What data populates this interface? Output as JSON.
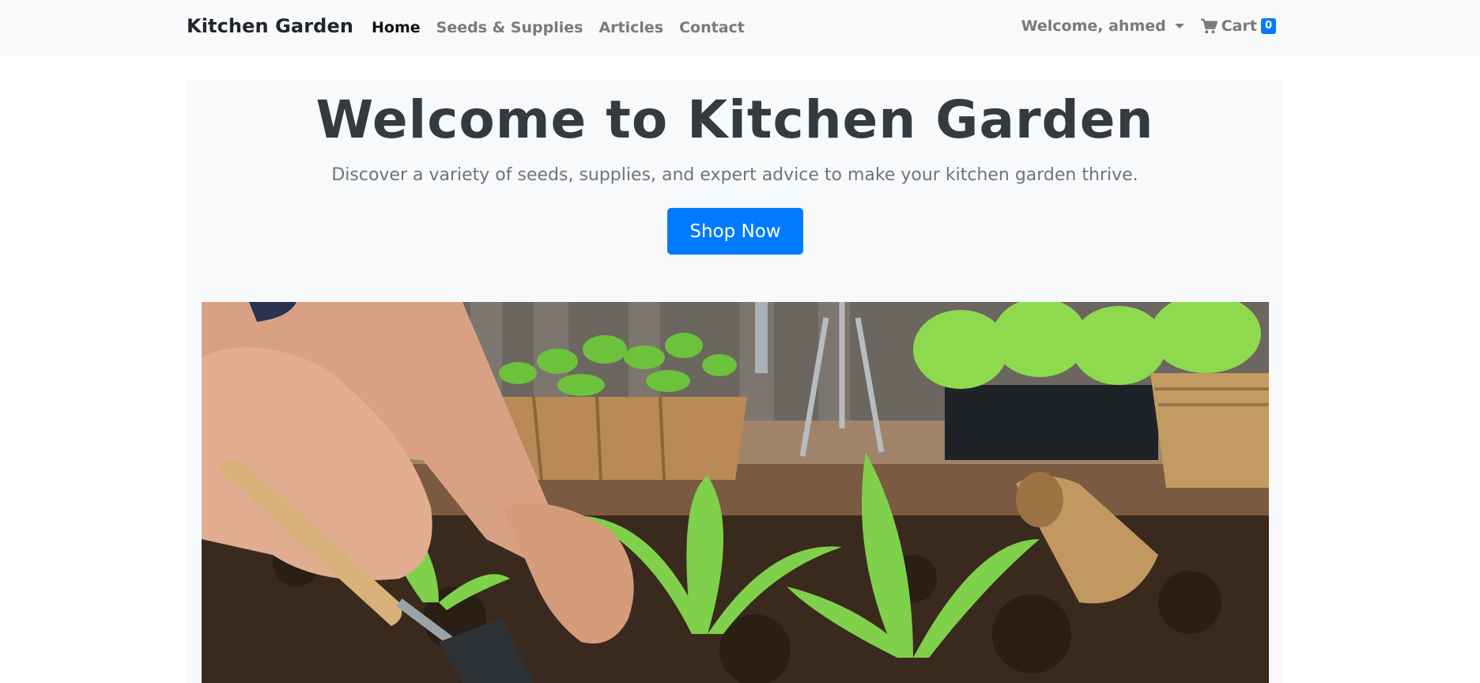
{
  "navbar": {
    "brand": "Kitchen Garden",
    "links": [
      {
        "label": "Home",
        "active": true
      },
      {
        "label": "Seeds & Supplies",
        "active": false
      },
      {
        "label": "Articles",
        "active": false
      },
      {
        "label": "Contact",
        "active": false
      }
    ],
    "user_menu": "Welcome, ahmed",
    "cart_label": "Cart",
    "cart_count": "0"
  },
  "hero": {
    "title": "Welcome to Kitchen Garden",
    "subtitle": "Discover a variety of seeds, supplies, and expert advice to make your kitchen garden thrive.",
    "cta_label": "Shop Now"
  },
  "colors": {
    "primary": "#007bff",
    "navbar_bg": "#f8f9fa",
    "hero_bg": "#f8f9fa",
    "title": "#343a40",
    "muted": "#6c757d"
  },
  "icons": {
    "cart": "shopping-cart-icon",
    "dropdown": "caret-down-icon"
  }
}
